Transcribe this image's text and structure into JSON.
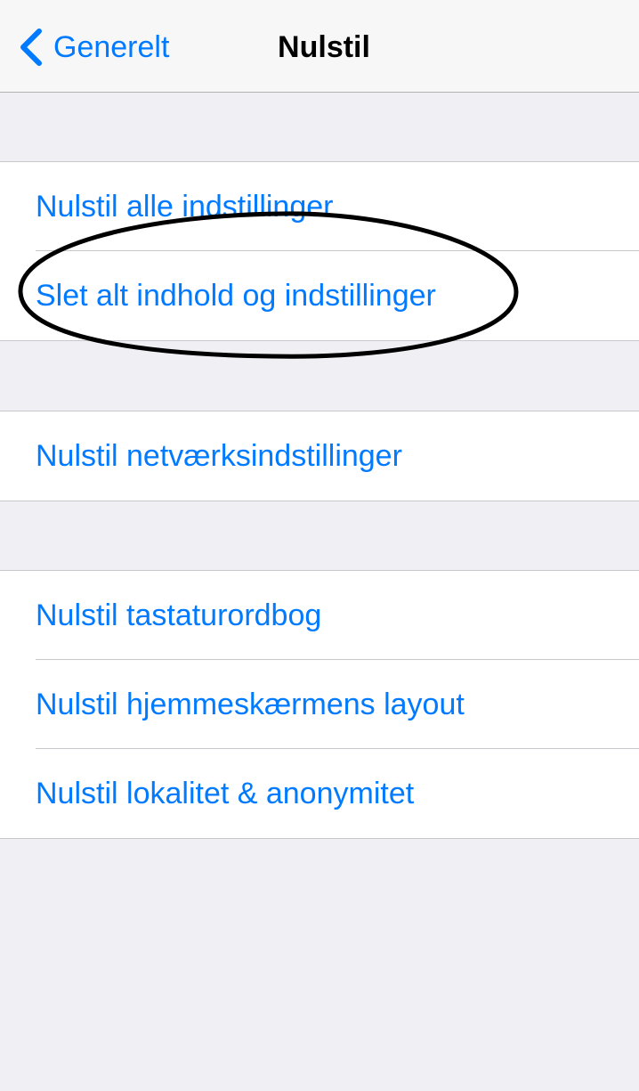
{
  "nav": {
    "back_label": "Generelt",
    "title": "Nulstil"
  },
  "groups": [
    {
      "items": [
        {
          "label": "Nulstil alle indstillinger"
        },
        {
          "label": "Slet alt indhold og indstillinger"
        }
      ]
    },
    {
      "items": [
        {
          "label": "Nulstil netværksindstillinger"
        }
      ]
    },
    {
      "items": [
        {
          "label": "Nulstil tastaturordbog"
        },
        {
          "label": "Nulstil hjemmeskærmens layout"
        },
        {
          "label": "Nulstil lokalitet & anonymitet"
        }
      ]
    }
  ],
  "colors": {
    "accent": "#007aff",
    "background": "#efeff4",
    "cell": "#ffffff",
    "separator": "#c8c7cc",
    "annotation": "#000000"
  },
  "icons": {
    "back": "chevron-left-icon"
  },
  "annotation": {
    "type": "hand-drawn ellipse",
    "target": "Slet alt indhold og indstillinger"
  }
}
